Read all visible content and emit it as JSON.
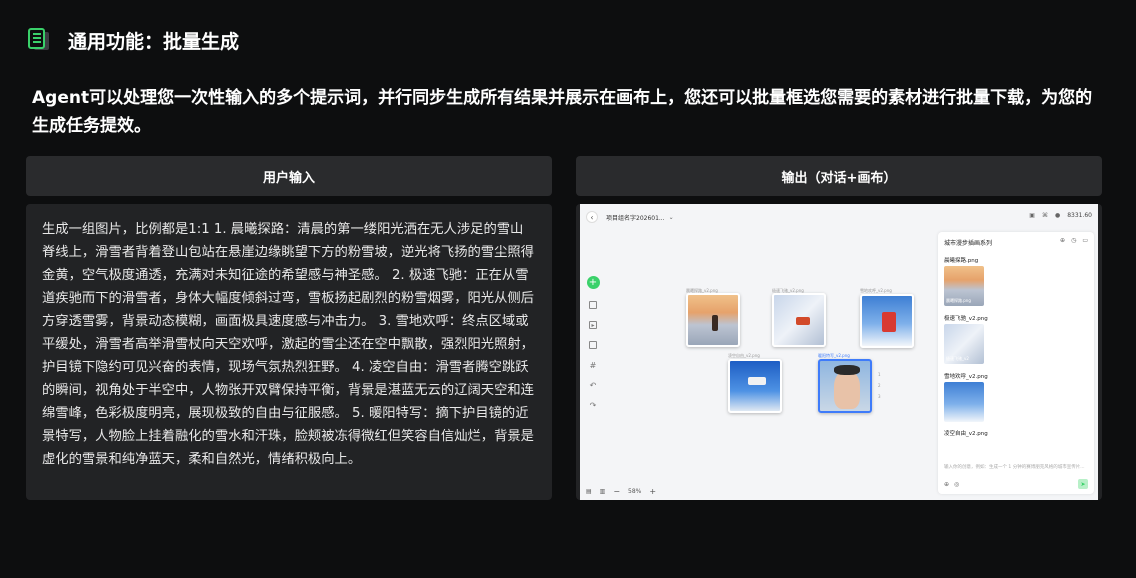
{
  "header": {
    "title": "通用功能：批量生成",
    "icon": "document-icon",
    "accent": "#3ad16a"
  },
  "description": "Agent可以处理您一次性输入的多个提示词，并行同步生成所有结果并展示在画布上，您还可以批量框选您需要的素材进行批量下载，为您的生成任务提效。",
  "columns": {
    "left_title": "用户输入",
    "right_title": "输出（对话+画布）"
  },
  "user_input": "生成一组图片，比例都是1:1 1. 晨曦探路：清晨的第一缕阳光洒在无人涉足的雪山脊线上，滑雪者背着登山包站在悬崖边缘眺望下方的粉雪坡，逆光将飞扬的雪尘照得金黄，空气极度通透，充满对未知征途的希望感与神圣感。 2. 极速飞驰：正在从雪道疾驰而下的滑雪者，身体大幅度倾斜过弯，雪板扬起剧烈的粉雪烟雾，阳光从侧后方穿透雪雾，背景动态模糊，画面极具速度感与冲击力。 3. 雪地欢呼：终点区域或平缓处，滑雪者高举滑雪杖向天空欢呼，激起的雪尘还在空中飘散，强烈阳光照射，护目镜下隐约可见兴奋的表情，现场气氛热烈狂野。 4. 凌空自由：滑雪者腾空跳跃的瞬间，视角处于半空中，人物张开双臂保持平衡，背景是湛蓝无云的辽阔天空和连绵雪峰，色彩极度明亮，展现极致的自由与征服感。 5. 暖阳特写：摘下护目镜的近景特写，人物脸上挂着融化的雪水和汗珠，脸颊被冻得微红但笑容自信灿烂，背景是虚化的雪景和纯净蓝天，柔和自然光，情绪积极向上。",
  "screenshot": {
    "project_name": "项目组名字202601...",
    "credits": "8331.60",
    "zoom": "58%",
    "panel_title": "城市漫步插画系列",
    "files": [
      {
        "name": "晨曦探路.png",
        "thumb_label": "晨曦探路.png"
      },
      {
        "name": "极速飞驰_v2.png",
        "thumb_label": "极速飞驰_v2"
      },
      {
        "name": "雪地欢呼_v2.png",
        "thumb_label": ""
      },
      {
        "name": "凌空自由_v2.png",
        "thumb_label": ""
      }
    ],
    "composer_placeholder": "输入你的创意，例如：生成一个 1 分钟的赛博朋克风格的城市宣传片...",
    "canvas_labels": [
      "晨曦探路_v2.png",
      "极速飞驰_v2.png",
      "雪地欢呼_v2.png",
      "凌空自由_v2.png",
      "暖阳特写_v2.png"
    ],
    "side_numbers": [
      "1",
      "2",
      "3"
    ]
  }
}
